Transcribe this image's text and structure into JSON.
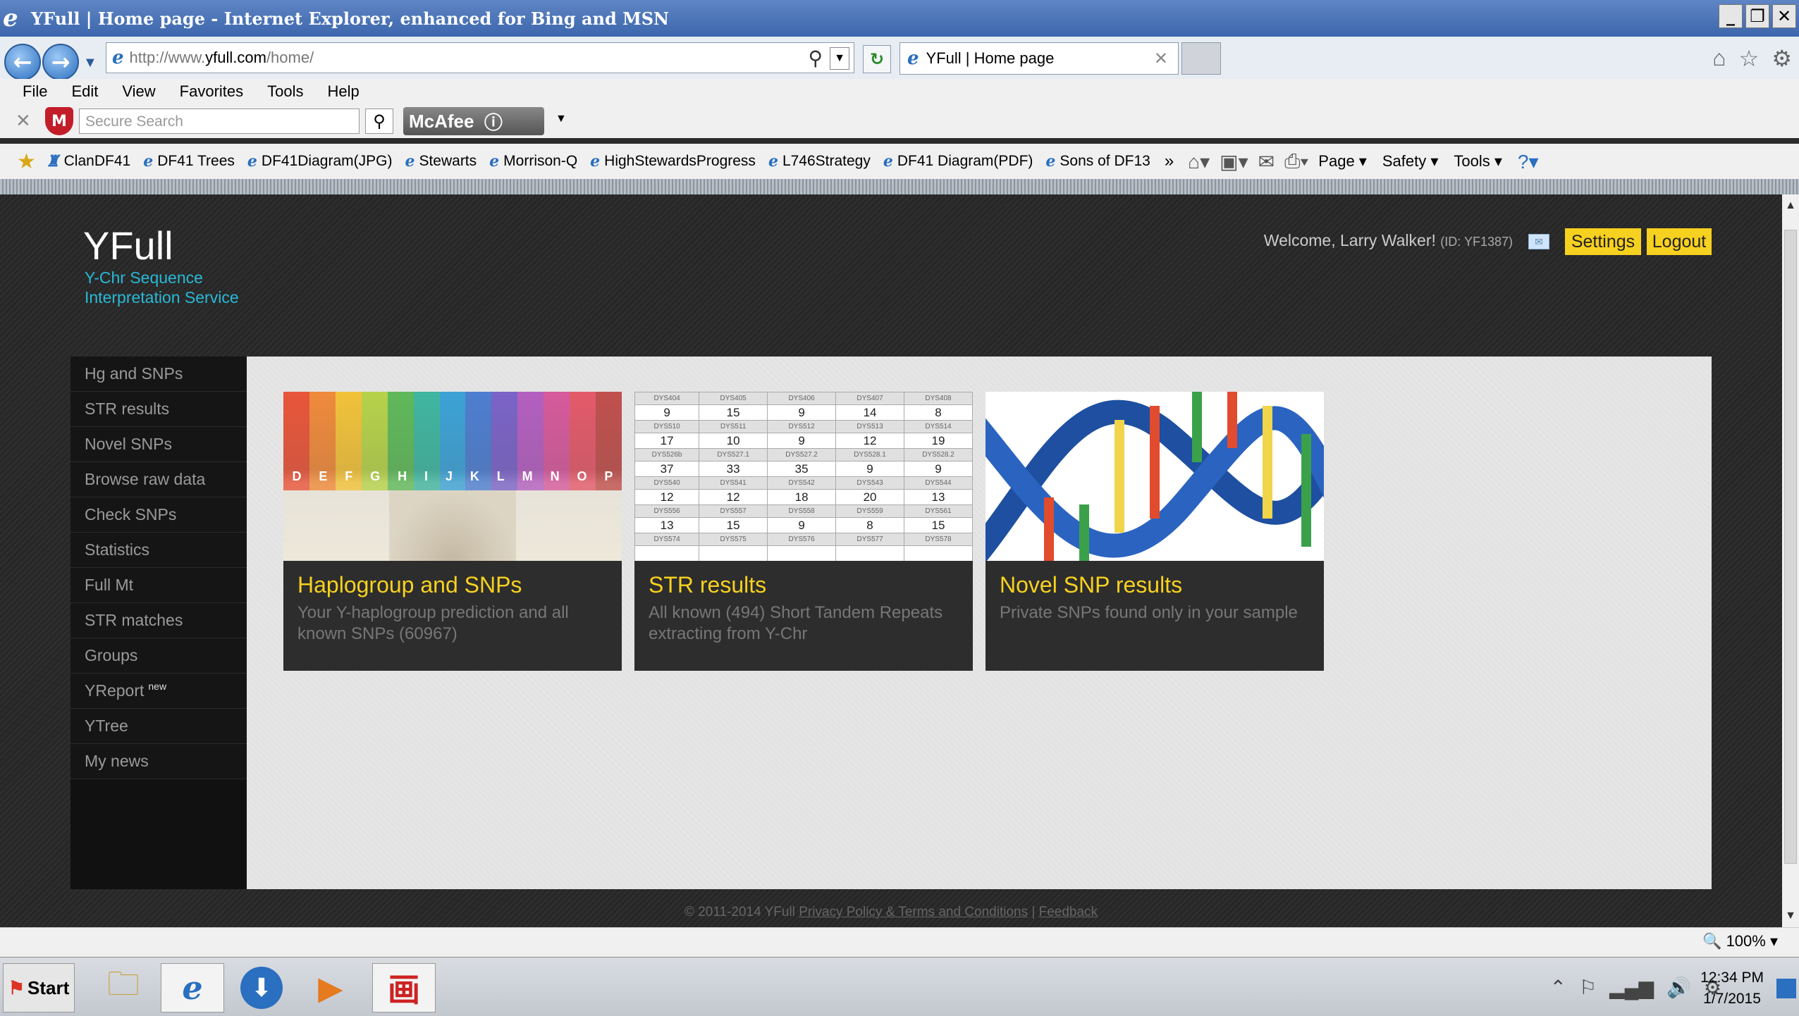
{
  "window": {
    "title": "YFull | Home page - Internet Explorer, enhanced for Bing and MSN"
  },
  "addressbar": {
    "url_prefix": "http://www.",
    "url_domain": "yfull.com",
    "url_suffix": "/home/",
    "tab_title": "YFull | Home page"
  },
  "menu": [
    "File",
    "Edit",
    "View",
    "Favorites",
    "Tools",
    "Help"
  ],
  "mcafee": {
    "search_placeholder": "Secure Search",
    "brand": "McAfee"
  },
  "favorites": [
    "ClanDF41",
    "DF41 Trees",
    "DF41Diagram(JPG)",
    "Stewarts",
    "Morrison-Q",
    "HighStewardsProgress",
    "L746Strategy",
    "DF41 Diagram(PDF)",
    "Sons of DF13"
  ],
  "commandbar": [
    "Page",
    "Safety",
    "Tools"
  ],
  "site": {
    "logo": "YFull",
    "tagline": "Y-Chr Sequence Interpretation Service",
    "welcome": "Welcome, Larry Walker!",
    "user_id": "(ID: YF1387)",
    "settings": "Settings",
    "logout": "Logout",
    "sidebar": [
      {
        "label": "Hg and SNPs"
      },
      {
        "label": "STR results"
      },
      {
        "label": "Novel SNPs"
      },
      {
        "label": "Browse raw data"
      },
      {
        "label": "Check SNPs"
      },
      {
        "label": "Statistics"
      },
      {
        "label": "Full Mt"
      },
      {
        "label": "STR matches"
      },
      {
        "label": "Groups"
      },
      {
        "label": "YReport",
        "badge": "new"
      },
      {
        "label": "YTree"
      },
      {
        "label": "My news"
      }
    ],
    "cards": [
      {
        "title": "Haplogroup and SNPs",
        "desc": "Your Y-haplogroup prediction and all known SNPs (60967)"
      },
      {
        "title": "STR results",
        "desc": "All known (494) Short Tandem Repeats extracting from Y-Chr"
      },
      {
        "title": "Novel SNP results",
        "desc": "Private SNPs found only in your sample"
      }
    ],
    "card1_letters": [
      "D",
      "E",
      "F",
      "G",
      "H",
      "I",
      "J",
      "K",
      "L",
      "M",
      "N",
      "O",
      "P"
    ],
    "str_grid": [
      {
        "headers": [
          "DYS404",
          "DYS405",
          "DYS406",
          "DYS407",
          "DYS408"
        ],
        "values": [
          "9",
          "15",
          "9",
          "14",
          "8"
        ]
      },
      {
        "headers": [
          "DYS510",
          "DYS511",
          "DYS512",
          "DYS513",
          "DYS514"
        ],
        "values": [
          "17",
          "10",
          "9",
          "12",
          "19"
        ]
      },
      {
        "headers": [
          "DYS526b",
          "DYS527.1",
          "DYS527.2",
          "DYS528.1",
          "DYS528.2"
        ],
        "values": [
          "37",
          "33",
          "35",
          "9",
          "9"
        ]
      },
      {
        "headers": [
          "DYS540",
          "DYS541",
          "DYS542",
          "DYS543",
          "DYS544"
        ],
        "values": [
          "12",
          "12",
          "18",
          "20",
          "13"
        ]
      },
      {
        "headers": [
          "DYS556",
          "DYS557",
          "DYS558",
          "DYS559",
          "DYS561"
        ],
        "values": [
          "13",
          "15",
          "9",
          "8",
          "15"
        ]
      },
      {
        "headers": [
          "DYS574",
          "DYS575",
          "DYS576",
          "DYS577",
          "DYS578"
        ],
        "values": [
          "",
          "",
          "",
          "",
          ""
        ]
      }
    ],
    "footer": {
      "copyright": "© 2011-2014 YFull",
      "privacy": "Privacy Policy & Terms and Conditions",
      "sep": "|",
      "feedback": "Feedback"
    }
  },
  "statusbar": {
    "zoom": "100%"
  },
  "taskbar": {
    "start": "Start",
    "time": "12:34 PM",
    "date": "1/7/2015"
  },
  "colors": {
    "accent_yellow": "#f7d11f",
    "tagline_blue": "#29b9d6",
    "card_bg": "#2d2d2d"
  }
}
